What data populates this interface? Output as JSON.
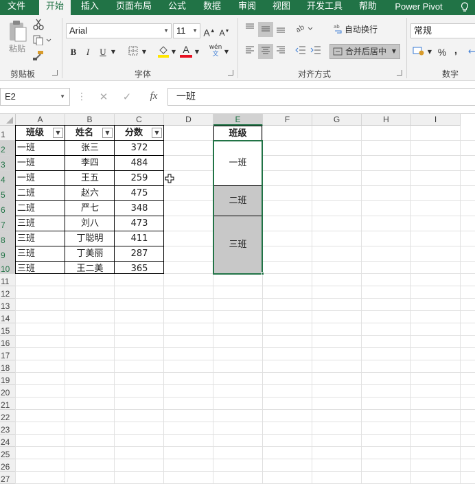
{
  "ribbon_tabs": [
    {
      "label": "文件",
      "active": false
    },
    {
      "label": "开始",
      "active": true
    },
    {
      "label": "插入",
      "active": false
    },
    {
      "label": "页面布局",
      "active": false
    },
    {
      "label": "公式",
      "active": false
    },
    {
      "label": "数据",
      "active": false
    },
    {
      "label": "审阅",
      "active": false
    },
    {
      "label": "视图",
      "active": false
    },
    {
      "label": "开发工具",
      "active": false
    },
    {
      "label": "帮助",
      "active": false
    },
    {
      "label": "Power Pivot",
      "active": false
    }
  ],
  "clipboard": {
    "paste_label": "粘贴",
    "group_label": "剪贴板"
  },
  "font": {
    "name": "Arial",
    "size": "11",
    "group_label": "字体",
    "bold": "B",
    "italic": "I",
    "underline": "U",
    "phonetic": "wén",
    "grow": "A",
    "shrink": "A",
    "font_color_letter": "A"
  },
  "alignment": {
    "wrap_label": "自动换行",
    "merge_label": "合并后居中",
    "group_label": "对齐方式"
  },
  "number": {
    "format": "常规",
    "group_label": "数字",
    "percent": "%",
    "comma": ","
  },
  "formula_bar": {
    "name_box": "E2",
    "fx": "fx",
    "value": "一班"
  },
  "colors": {
    "accent": "#217346",
    "ribbon_bg": "#f3f3f3",
    "selection_fill": "#c8c8c8",
    "font_color_bar": "#e81123",
    "fill_color_bar": "#ffe600"
  },
  "columns": [
    "A",
    "B",
    "C",
    "D",
    "E",
    "F",
    "G",
    "H",
    "I"
  ],
  "rows": [
    "1",
    "2",
    "3",
    "4",
    "5",
    "6",
    "7",
    "8",
    "9",
    "10",
    "11",
    "12",
    "13",
    "14",
    "15",
    "16",
    "17",
    "18",
    "19",
    "20",
    "21",
    "22",
    "23",
    "24",
    "25",
    "26",
    "27"
  ],
  "table": {
    "headers": [
      "班级",
      "姓名",
      "分数"
    ],
    "rows": [
      [
        "一班",
        "张三",
        "372"
      ],
      [
        "一班",
        "李四",
        "484"
      ],
      [
        "一班",
        "王五",
        "259"
      ],
      [
        "二班",
        "赵六",
        "475"
      ],
      [
        "二班",
        "严七",
        "348"
      ],
      [
        "三班",
        "刘八",
        "473"
      ],
      [
        "三班",
        "丁聪明",
        "411"
      ],
      [
        "三班",
        "丁美丽",
        "287"
      ],
      [
        "三班",
        "王二美",
        "365"
      ]
    ]
  },
  "merged": {
    "header": "班级",
    "groups": [
      "一班",
      "二班",
      "三班"
    ]
  }
}
